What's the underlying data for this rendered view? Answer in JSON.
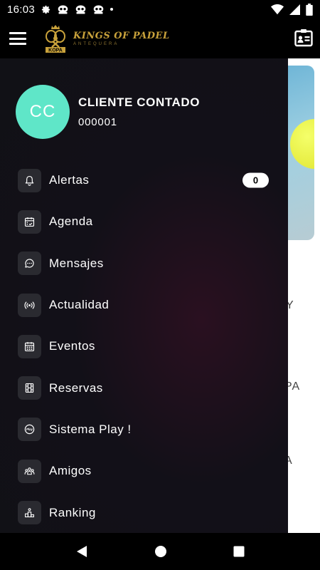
{
  "status_bar": {
    "time": "16:03"
  },
  "app_bar": {
    "logo_badge": "KOPA",
    "logo_title": "KINGS OF PADEL",
    "logo_subtitle": "ANTEQUERA"
  },
  "profile": {
    "initials": "CC",
    "name": "CLIENTE CONTADO",
    "id": "000001",
    "avatar_color": "#5fe6c8"
  },
  "menu": [
    {
      "label": "Alertas",
      "icon": "bell-icon",
      "badge": "0"
    },
    {
      "label": "Agenda",
      "icon": "calendar-check-icon"
    },
    {
      "label": "Mensajes",
      "icon": "chat-bubble-icon"
    },
    {
      "label": "Actualidad",
      "icon": "broadcast-icon"
    },
    {
      "label": "Eventos",
      "icon": "calendar-grid-icon"
    },
    {
      "label": "Reservas",
      "icon": "film-strip-icon"
    },
    {
      "label": "Sistema Play !",
      "icon": "play-badge-icon"
    },
    {
      "label": "Amigos",
      "icon": "group-icon"
    },
    {
      "label": "Ranking",
      "icon": "podium-icon"
    }
  ],
  "background_page": {
    "text_fragments": [
      "Y",
      "PA",
      "A"
    ]
  }
}
